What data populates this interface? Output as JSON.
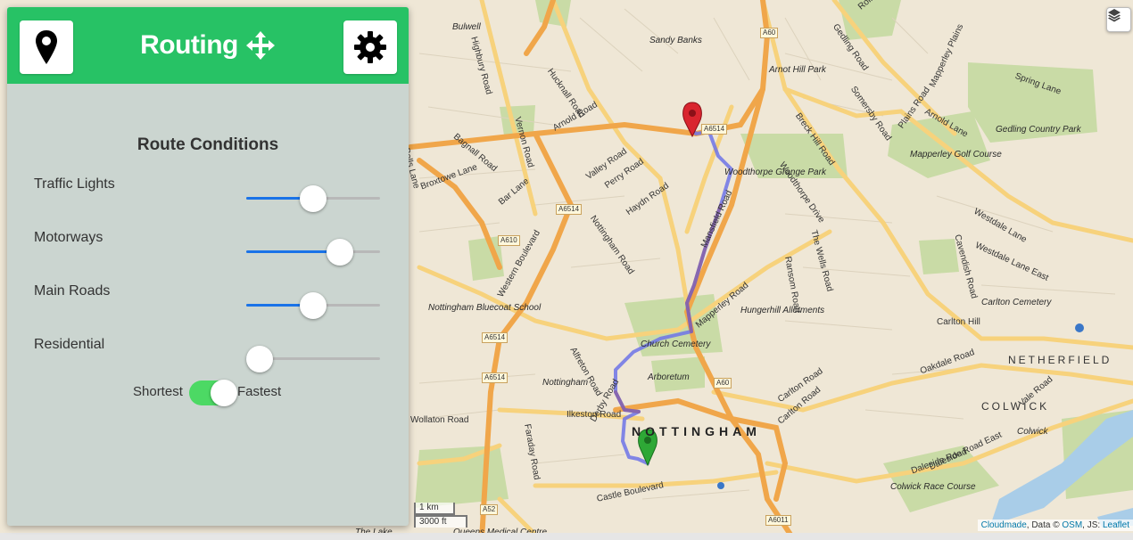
{
  "panel": {
    "title": "Routing",
    "section_title": "Route Conditions",
    "conditions": [
      {
        "label": "Traffic Lights",
        "value": 0.5
      },
      {
        "label": "Motorways",
        "value": 0.7
      },
      {
        "label": "Main Roads",
        "value": 0.5
      },
      {
        "label": "Residential",
        "value": 0.1
      }
    ],
    "toggle": {
      "left_label": "Shortest",
      "right_label": "Fastest",
      "selected": "Fastest"
    },
    "icons": {
      "left": "map-marker-icon",
      "title": "move-arrows-icon",
      "right": "gear-icon"
    }
  },
  "map": {
    "city": "NOTTINGHAM",
    "districts": [
      "NETHERFIELD",
      "COLWICK"
    ],
    "places": [
      "Sandy Banks",
      "Arnot Hill Park",
      "Gedling Country Park",
      "Mapperley Golf Course",
      "Woodthorpe Grange Park",
      "Hungerhill Allotments",
      "Nottingham Bluecoat School",
      "Church Cemetery",
      "Arboretum",
      "Nottingham",
      "Carlton Cemetery",
      "Colwick Race Course",
      "Colwick",
      "Queens Medical Centre",
      "The Lake",
      "Bulwell"
    ],
    "roads": [
      "Spring Lane",
      "Hucknall Road",
      "Arnold Road",
      "Valley Road",
      "Perry Road",
      "Haydn Road",
      "Nottingham Road",
      "Mansfield Road",
      "Mapperley Road",
      "Woodthorpe Drive",
      "Breck Hill Road",
      "Somersby Road",
      "Plains Road",
      "Arnold Lane",
      "Westdale Lane",
      "Westdale Lane East",
      "Cavendish Road",
      "Ransom Road",
      "The Wells Road",
      "Carlton Hill",
      "Oakdale Road",
      "Vale Road",
      "Daleside Road",
      "Daleside Road East",
      "Carlton Road",
      "Alfreton Road",
      "Derby Road",
      "Ilkeston Road",
      "Wollaton Road",
      "Faraday Road",
      "Castle Boulevard",
      "Western Boulevard",
      "Bagnall Road",
      "Broxtowe Lane",
      "Bar Lane",
      "Gedling Road",
      "Rolleston Drive",
      "Mapperley Plains",
      "Highbury Road",
      "Vernon Road",
      "Bells Lane",
      "Carlton Road"
    ],
    "road_badges": [
      "A60",
      "A6514",
      "A6514",
      "A610",
      "A6514",
      "A6514",
      "A60",
      "A52",
      "A6011"
    ],
    "scale": {
      "metric": "1 km",
      "imperial": "3000 ft"
    },
    "attribution": {
      "provider": "Cloudmade",
      "data_prefix": "Data ©",
      "osm": "OSM",
      "js_prefix": "JS:",
      "leaflet": "Leaflet"
    },
    "colors": {
      "route_primary": "#6d73e8",
      "route_alt": "#8a5a9a",
      "start_marker": "#2ea836",
      "end_marker": "#d9252f",
      "major_road": "#f0a64a",
      "secondary_road": "#f7d27c"
    }
  }
}
